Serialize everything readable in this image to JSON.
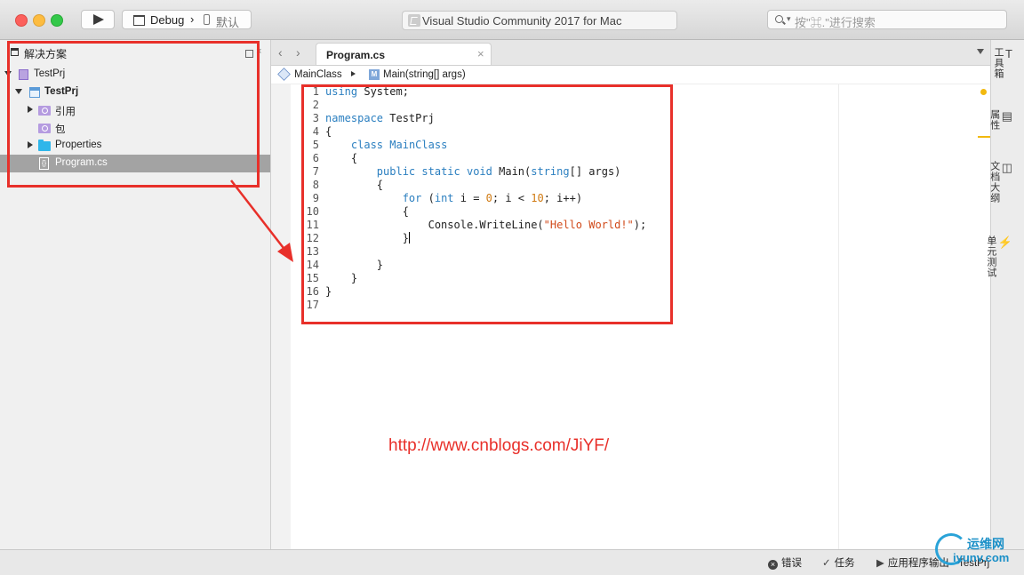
{
  "toolbar": {
    "config": "Debug",
    "separator": "›",
    "device": "默认",
    "window_title": "Visual Studio Community 2017 for Mac",
    "search_placeholder": "按\"⌘.\"进行搜索"
  },
  "solution_pad": {
    "title": "解决方案",
    "items": [
      {
        "label": "TestPrj",
        "type": "solution"
      },
      {
        "label": "TestPrj",
        "type": "project"
      },
      {
        "label": "引用",
        "type": "references"
      },
      {
        "label": "包",
        "type": "packages"
      },
      {
        "label": "Properties",
        "type": "folder"
      },
      {
        "label": "Program.cs",
        "type": "file",
        "selected": true
      }
    ]
  },
  "editor": {
    "tab": "Program.cs",
    "breadcrumb": {
      "class": "MainClass",
      "method": "Main(string[] args)"
    },
    "line_numbers": [
      "1",
      "2",
      "3",
      "4",
      "5",
      "6",
      "7",
      "8",
      "9",
      "10",
      "11",
      "12",
      "13",
      "14",
      "15",
      "16",
      "17"
    ]
  },
  "right_pad": {
    "toolbox": "工具箱",
    "properties": "属性",
    "outline": "文档大纲",
    "unit_tests": "单元测试"
  },
  "statusbar": {
    "errors": "错误",
    "tasks": "任务",
    "app_output": "应用程序输出 - TestPrj"
  },
  "annotation": {
    "url": "http://www.cnblogs.com/JiYF/",
    "color": "#e8302a"
  },
  "watermark_logo": {
    "cn": "运维网",
    "en": "iyunv.com"
  }
}
